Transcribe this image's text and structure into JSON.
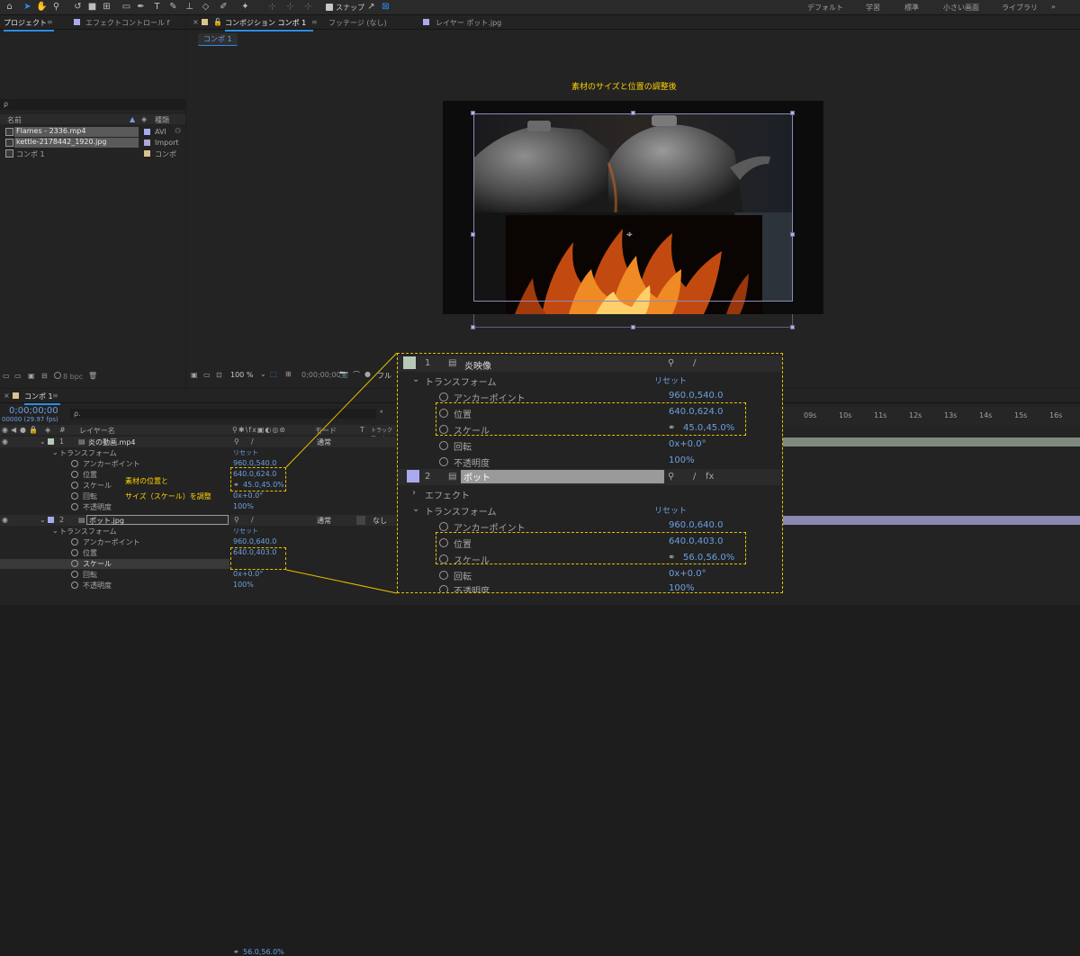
{
  "toolbar": {
    "snap_label": "スナップ",
    "workspaces": [
      "デフォルト",
      "学習",
      "標準",
      "小さい画面",
      "ライブラリ"
    ]
  },
  "project": {
    "tab_project": "プロジェクト",
    "tab_effects": "エフェクトコントロール f",
    "search_placeholder": "ρ",
    "col_name": "名前",
    "col_type": "種類",
    "items": [
      {
        "name": "Flames - 2336.mp4",
        "type": "AVI",
        "color": "#a9a9ef"
      },
      {
        "name": "kettle-2178442_1920.jpg",
        "type": "Import",
        "color": "#b2a6d8"
      },
      {
        "name": "コンポ 1",
        "type": "コンポ",
        "color": "#d7c48f"
      }
    ],
    "bpc": "8 bpc"
  },
  "viewer": {
    "tab_comp_prefix": "コンポジション",
    "tab_comp_name": "コンポ 1",
    "tab_footage": "フッテージ (なし)",
    "tab_layer": "レイヤー ポット.jpg",
    "breadcrumb": "コンポ 1",
    "caption": "素材のサイズと位置の調整後",
    "zoom": "100 %",
    "timecode": "0;00;00;00",
    "quality": "フル"
  },
  "timeline": {
    "tab": "コンポ 1",
    "timecode": "0;00;00;00",
    "fps": "00000 (29.97 fps)",
    "search_placeholder": "ρ.",
    "col_layer_name": "レイヤー名",
    "col_mode": "モード",
    "col_t": "T",
    "col_trackmat": "トラックマット",
    "ruler_ticks": [
      "09s",
      "10s",
      "11s",
      "12s",
      "13s",
      "14s",
      "15s",
      "16s"
    ],
    "layers": [
      {
        "num": "1",
        "name": "炎の動画.mp4",
        "mode": "通常",
        "color": "#b8c9b8",
        "transform": "トランスフォーム",
        "reset": "リセット",
        "anchor_label": "アンカーポイント",
        "anchor": "960.0,540.0",
        "position_label": "位置",
        "position": "640.0,624.0",
        "scale_label": "スケール",
        "scale": "45.0,45.0%",
        "rotation_label": "回転",
        "rotation": "0x+0.0°",
        "opacity_label": "不透明度",
        "opacity": "100%"
      },
      {
        "num": "2",
        "name": "ポット.jpg",
        "mode": "通常",
        "trackmat": "なし",
        "color": "#a9a9ef",
        "transform": "トランスフォーム",
        "reset": "リセット",
        "anchor_label": "アンカーポイント",
        "anchor": "960.0,640.0",
        "position_label": "位置",
        "position": "640.0,403.0",
        "scale_label": "スケール",
        "scale": "56.0,56.0%",
        "rotation_label": "回転",
        "rotation": "0x+0.0°",
        "opacity_label": "不透明度",
        "opacity": "100%"
      }
    ],
    "annotation_line1": "素材の位置と",
    "annotation_line2": "サイズ（スケール）を調整"
  },
  "zoom": {
    "layer1_num": "1",
    "layer1_name": "炎映像",
    "layer2_num": "2",
    "layer2_name": "ポット",
    "effects": "エフェクト",
    "transform": "トランスフォーム",
    "reset": "リセット",
    "anchor_label": "アンカーポイント",
    "position_label": "位置",
    "scale_label": "スケール",
    "rotation_label": "回転",
    "opacity_label": "不透明度",
    "l1_anchor": "960.0,540.0",
    "l1_position": "640.0,624.0",
    "l1_scale": "45.0,45.0%",
    "l1_rotation": "0x+0.0°",
    "l1_opacity": "100%",
    "l2_anchor": "960.0,640.0",
    "l2_position": "640.0,403.0",
    "l2_scale": "56.0,56.0%",
    "l2_rotation": "0x+0.0°",
    "l2_opacity": "100%"
  },
  "colors": {
    "accent": "#2d8ceb",
    "annotation": "#ffd200",
    "value_blue": "#6e9fe0"
  }
}
